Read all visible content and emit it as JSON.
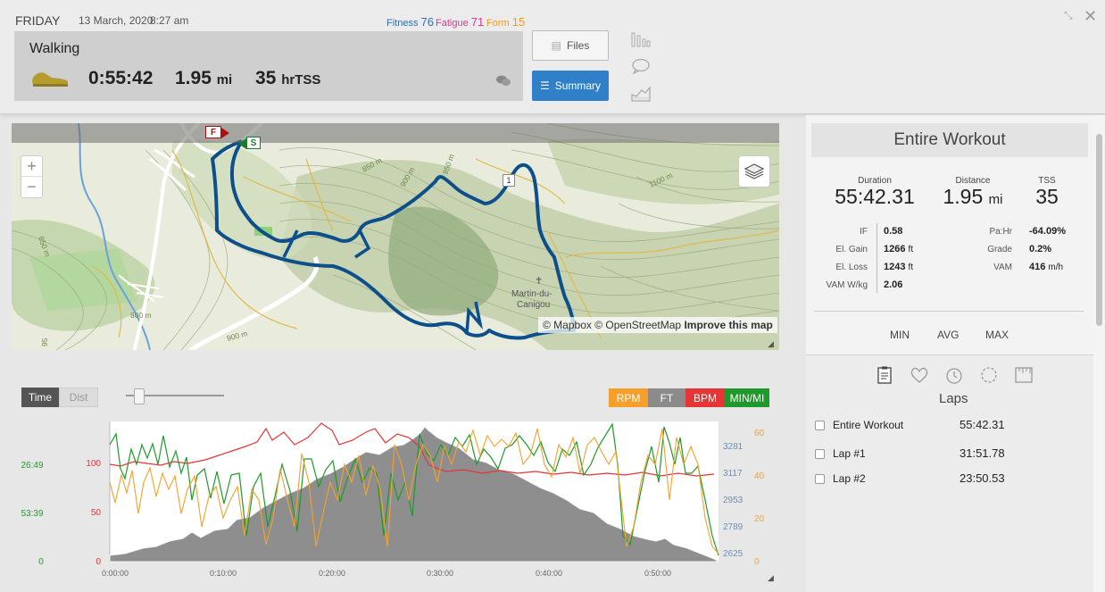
{
  "header": {
    "day": "FRIDAY",
    "date": "13 March, 2020",
    "time": "8:27 am",
    "fitness_label": "Fitness",
    "fitness_value": "76",
    "fatigue_label": "Fatigue",
    "fatigue_value": "71",
    "form_label": "Form",
    "form_value": "15",
    "colors": {
      "fitness": "#2a6fb0",
      "fatigue": "#e0309a",
      "form": "#f39a1e"
    }
  },
  "workout": {
    "sport": "Walking",
    "duration": "0:55:42",
    "distance": "1.95",
    "distance_unit": "mi",
    "tss": "35",
    "tss_unit": "hrTSS",
    "shoe_icon": "walking-shoe-icon"
  },
  "buttons": {
    "files": "Files",
    "summary": "Summary"
  },
  "map": {
    "attribution_mapbox": "© Mapbox",
    "attribution_osm": "© OpenStreetMap",
    "improve": "Improve this map",
    "place_name_1": "Martin-du-",
    "place_name_2": "Canigou",
    "marker_finish": "F",
    "marker_start": "S",
    "marker_lap": "1",
    "contour_labels": [
      "850 m",
      "900 m",
      "950 m",
      "1100 m",
      "850 m",
      "800 m",
      "900 m",
      "95"
    ],
    "zoom_in": "+",
    "zoom_out": "−"
  },
  "chart_controls": {
    "time": "Time",
    "dist": "Dist",
    "toggles": [
      "RPM",
      "FT",
      "BPM",
      "MIN/MI"
    ]
  },
  "chart_data": {
    "type": "line",
    "x_ticks": [
      "0:00:00",
      "0:10:00",
      "0:20:00",
      "0:30:00",
      "0:40:00",
      "0:50:00"
    ],
    "left_axis_pace": [
      "26:49",
      "53:39",
      "0"
    ],
    "left_axis_hr": [
      "100",
      "50",
      "0"
    ],
    "right_axis_elev": [
      "3281",
      "3117",
      "2953",
      "2789",
      "2625"
    ],
    "right_axis_cad": [
      "60",
      "40",
      "20",
      "0"
    ],
    "series": [
      {
        "name": "FT",
        "color": "#8b8b8b"
      },
      {
        "name": "BPM",
        "color": "#e53535"
      },
      {
        "name": "MIN/MI",
        "color": "#1f9a2a"
      },
      {
        "name": "RPM",
        "color": "#f6a02b"
      }
    ]
  },
  "summary_panel": {
    "title": "Entire Workout",
    "duration_label": "Duration",
    "duration_value": "55:42.31",
    "distance_label": "Distance",
    "distance_value": "1.95",
    "distance_unit": "mi",
    "tss_label": "TSS",
    "tss_value": "35",
    "left_kv": [
      {
        "label": "IF",
        "value": "0.58",
        "unit": ""
      },
      {
        "label": "El. Gain",
        "value": "1266",
        "unit": "ft"
      },
      {
        "label": "El. Loss",
        "value": "1243",
        "unit": "ft"
      },
      {
        "label": "VAM W/kg",
        "value": "2.06",
        "unit": ""
      }
    ],
    "right_kv": [
      {
        "label": "Pa:Hr",
        "value": "-64.09%",
        "unit": ""
      },
      {
        "label": "Grade",
        "value": "0.2%",
        "unit": ""
      },
      {
        "label": "VAM",
        "value": "416",
        "unit": "m/h"
      }
    ],
    "columns": [
      "MIN",
      "AVG",
      "MAX"
    ]
  },
  "laps": {
    "title": "Laps",
    "rows": [
      {
        "name": "Entire Workout",
        "time": "55:42.31"
      },
      {
        "name": "Lap #1",
        "time": "31:51.78"
      },
      {
        "name": "Lap #2",
        "time": "23:50.53"
      }
    ]
  }
}
